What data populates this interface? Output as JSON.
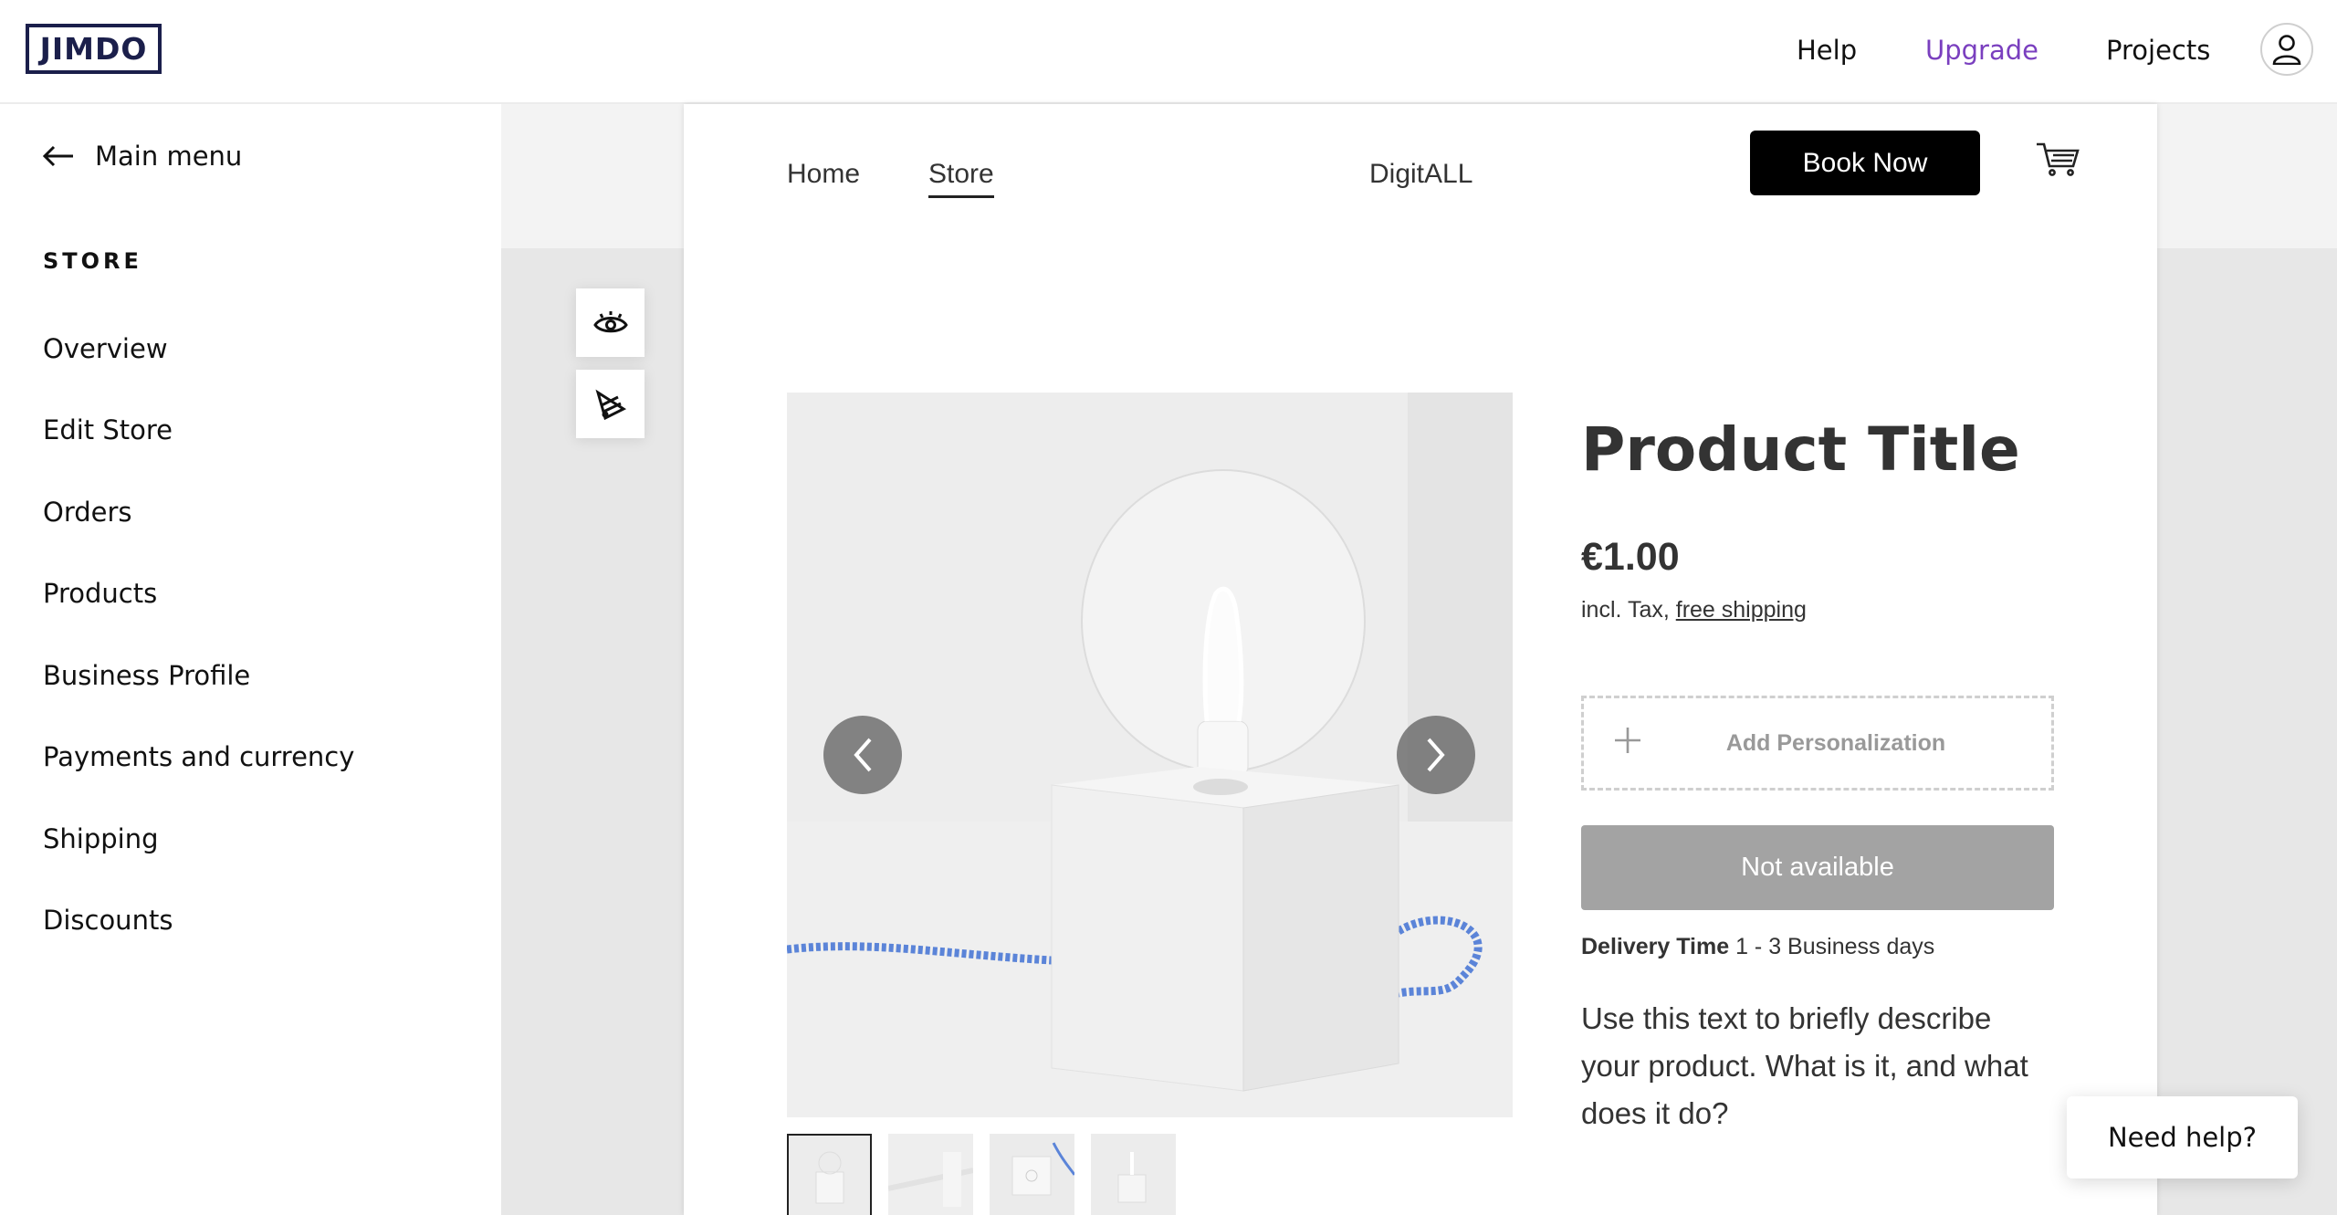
{
  "app": {
    "logo_text": "JIMDO"
  },
  "topnav": {
    "help": "Help",
    "upgrade": "Upgrade",
    "projects": "Projects",
    "upgrade_color": "#7a3fbf",
    "profile_icon": "user-icon"
  },
  "sidebar": {
    "back_label": "Main menu",
    "section_title": "STORE",
    "items": [
      {
        "label": "Overview"
      },
      {
        "label": "Edit Store"
      },
      {
        "label": "Orders"
      },
      {
        "label": "Products"
      },
      {
        "label": "Business Profile"
      },
      {
        "label": "Payments and currency"
      },
      {
        "label": "Shipping"
      },
      {
        "label": "Discounts"
      }
    ]
  },
  "tools": {
    "preview_icon": "eye-icon",
    "design_icon": "paint-palette-icon"
  },
  "site": {
    "nav": [
      {
        "label": "Home"
      },
      {
        "label": "Store"
      }
    ],
    "active_nav": "Store",
    "brand": "DigitALL",
    "cta_label": "Book Now",
    "cart_icon": "cart-icon"
  },
  "product": {
    "title": "Product Title",
    "price": "€1.00",
    "tax_prefix": "incl. Tax, ",
    "shipping_link": "free shipping",
    "personalization_label": "Add Personalization",
    "availability_button": "Not available",
    "delivery_label": "Delivery Time",
    "delivery_value": " 1 - 3 Business days",
    "description": "Use this text to briefly describe your product. What is it, and what does it do?",
    "thumbnail_count": 4
  },
  "help_button": "Need help?"
}
